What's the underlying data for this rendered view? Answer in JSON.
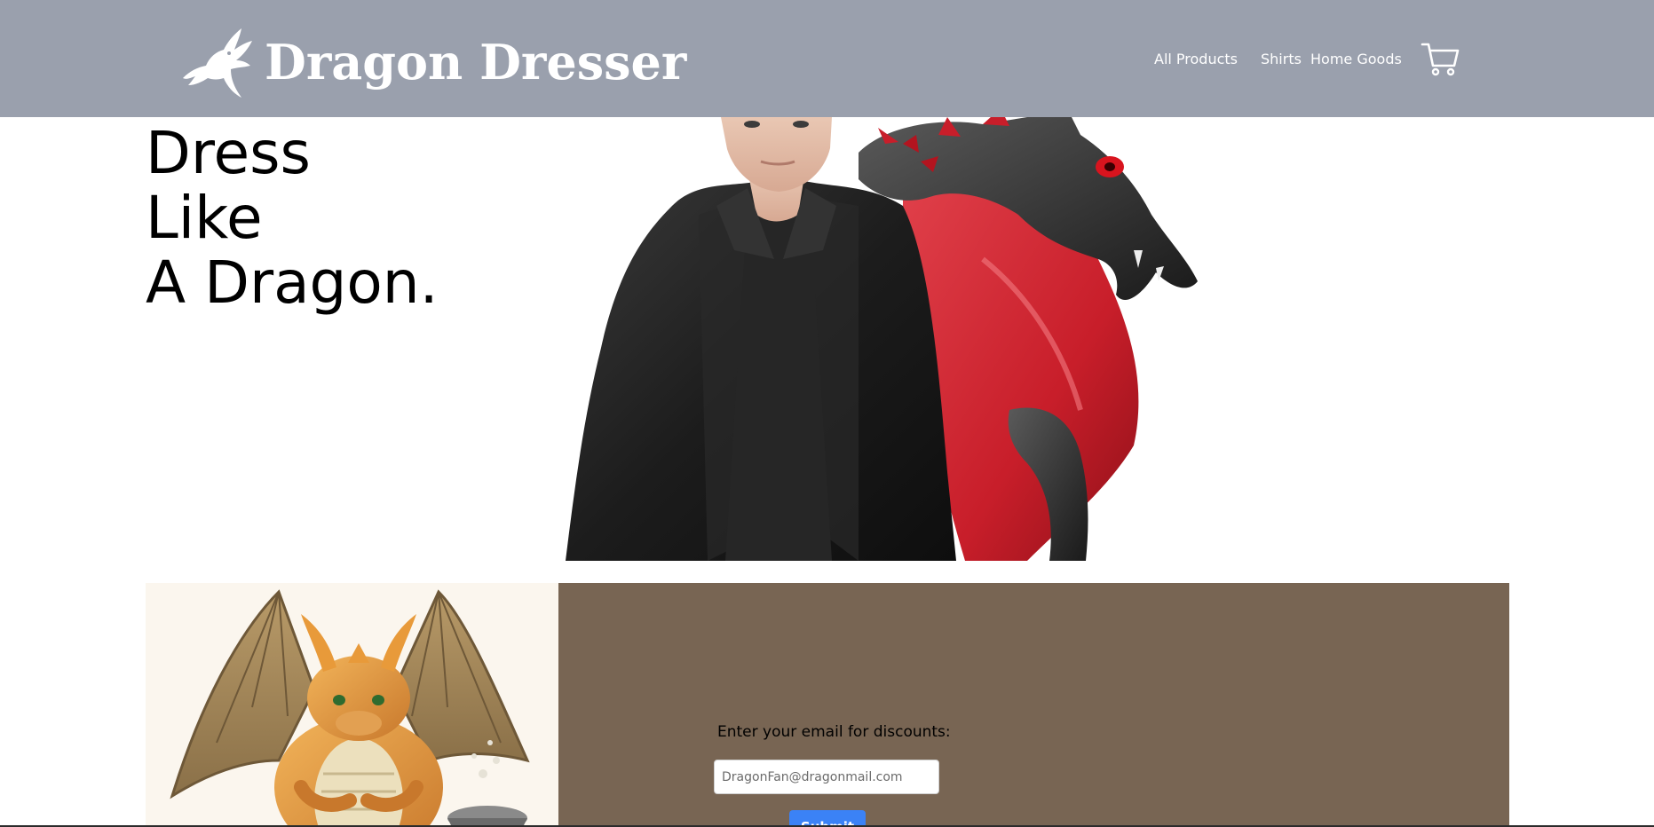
{
  "header": {
    "brand_name": "Dragon Dresser",
    "logo_icon": "dragon-logo-icon",
    "nav_links": [
      {
        "label": "All Products"
      },
      {
        "label": "Shirts"
      },
      {
        "label": "Home Goods"
      }
    ],
    "cart_icon": "shopping-cart-icon"
  },
  "hero": {
    "title_lines": [
      "Dress",
      "Like",
      "A Dragon."
    ],
    "image": "model-with-black-dragon-image"
  },
  "promo": {
    "image": "golden-baby-dragon-image",
    "label": "Enter your email for discounts:",
    "email_placeholder": "DragonFan@dragonmail.com",
    "submit_label": "Submit"
  },
  "colors": {
    "navbar_bg": "#9aa0ad",
    "promo_bg": "#786553",
    "button_bg": "#3b82f6",
    "text_dark": "#000000",
    "text_light": "#ffffff"
  }
}
